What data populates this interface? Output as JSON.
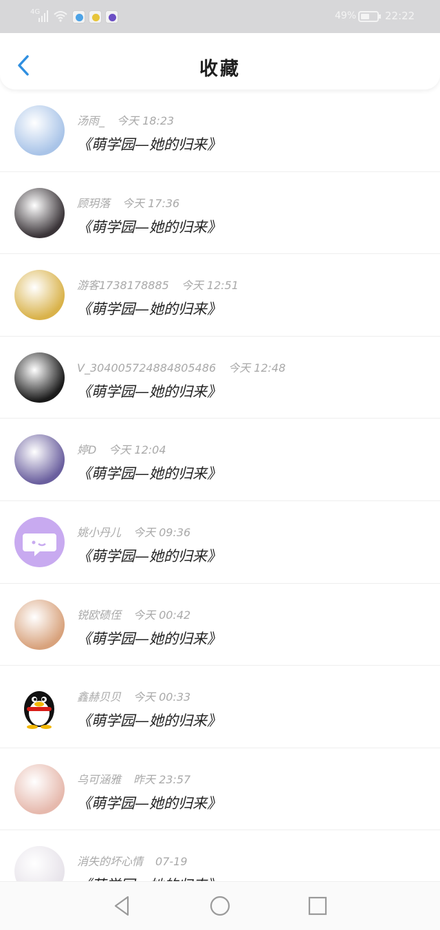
{
  "status_bar": {
    "signal_label": "4G",
    "battery_percent": "49%",
    "time": "22:22",
    "app_icons": [
      "app-icon-blue",
      "app-icon-yellow",
      "app-icon-purple"
    ]
  },
  "header": {
    "title": "收藏",
    "back_icon": "chevron-left-icon"
  },
  "favorites": [
    {
      "user": "汤雨_",
      "time": "今天 18:23",
      "content": "《萌学园—她的归来》",
      "avatar_color": "#a9c4e8"
    },
    {
      "user": "顾玥落",
      "time": "今天 17:36",
      "content": "《萌学园—她的归来》",
      "avatar_color": "#3a3438"
    },
    {
      "user": "游客1738178885",
      "time": "今天 12:51",
      "content": "《萌学园—她的归来》",
      "avatar_color": "#d9b24a"
    },
    {
      "user": "V_304005724884805486",
      "time": "今天 12:48",
      "content": "《萌学园—她的归来》",
      "avatar_color": "#1a1a1a"
    },
    {
      "user": "婷D",
      "time": "今天 12:04",
      "content": "《萌学园—她的归来》",
      "avatar_color": "#6a5f9e"
    },
    {
      "user": "姚小丹儿",
      "time": "今天 09:36",
      "content": "《萌学园—她的归来》",
      "avatar_color": "#c8aaf0"
    },
    {
      "user": "锐欧碛侄",
      "time": "今天 00:42",
      "content": "《萌学园—她的归来》",
      "avatar_color": "#d8a27c"
    },
    {
      "user": "鑫赫贝贝",
      "time": "今天 00:33",
      "content": "《萌学园—她的归来》",
      "avatar_color": "#ffffff"
    },
    {
      "user": "乌可涵雅",
      "time": "昨天 23:57",
      "content": "《萌学园—她的归来》",
      "avatar_color": "#e6b9ad"
    },
    {
      "user": "消失的坏心情",
      "time": "07-19",
      "content": "《萌学园—她的归来》",
      "avatar_color": "#e7e3ea"
    }
  ],
  "nav_bar": {
    "back": "triangle-back-icon",
    "home": "circle-home-icon",
    "recents": "square-recents-icon"
  }
}
